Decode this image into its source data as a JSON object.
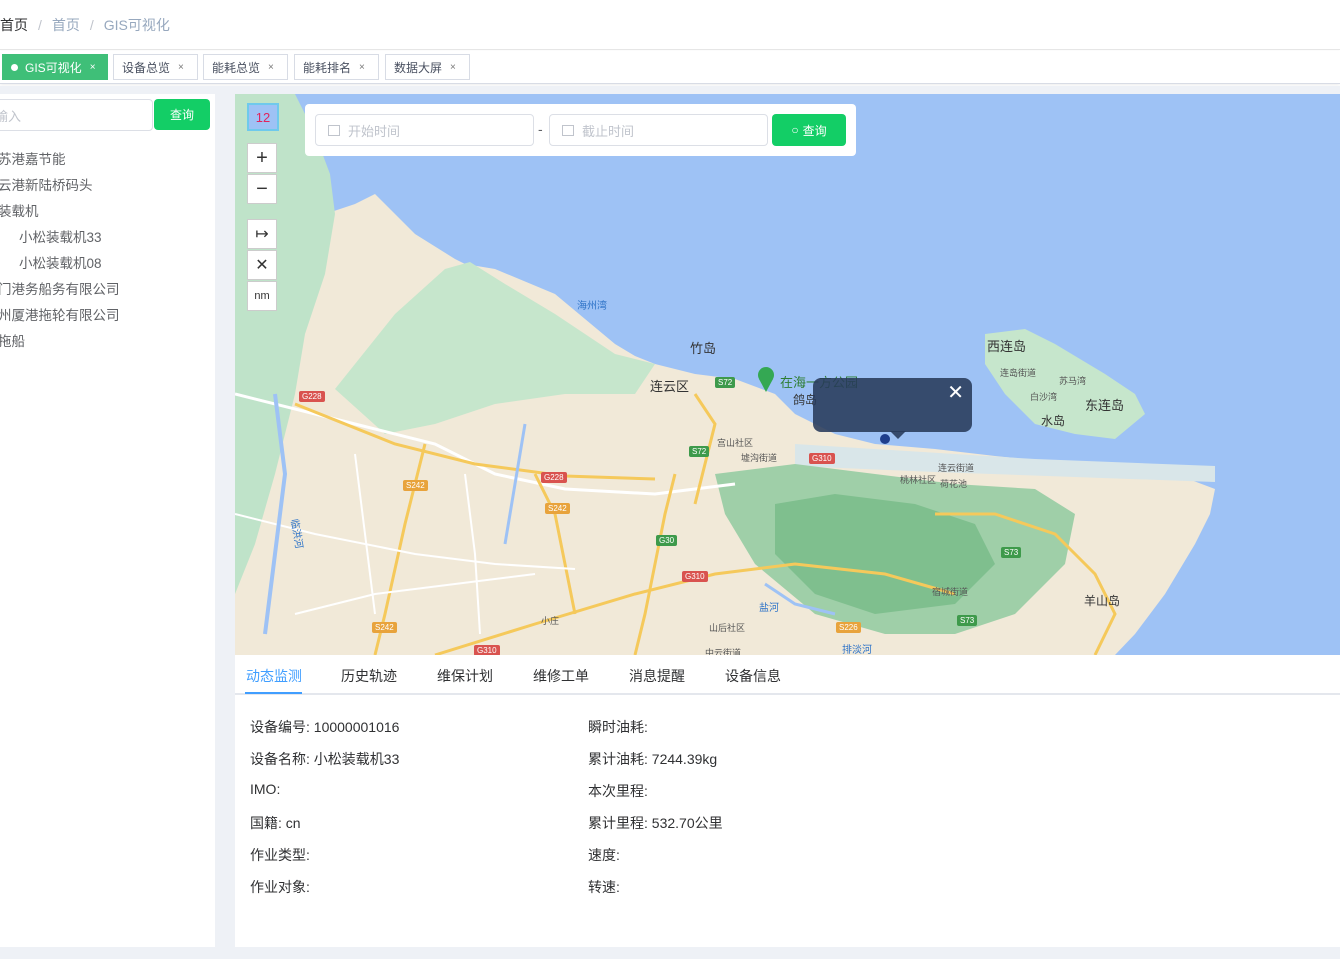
{
  "breadcrumb": [
    "首页",
    "首页",
    "GIS可视化"
  ],
  "tabs": [
    {
      "label": "GIS可视化",
      "active": true
    },
    {
      "label": "设备总览"
    },
    {
      "label": "能耗总览"
    },
    {
      "label": "能耗排名"
    },
    {
      "label": "数据大屏"
    }
  ],
  "tab_close": "×",
  "left": {
    "search_placeholder": "输入",
    "search_button": "查询",
    "tree": [
      "苏港嘉节能",
      "云港新陆桥码头",
      "装载机",
      "小松装载机33",
      "小松装载机08",
      "门港务船务有限公司",
      "州厦港拖轮有限公司",
      "拖船"
    ]
  },
  "map": {
    "zoom_level": "12",
    "zoom_in": "+",
    "zoom_out": "−",
    "measure": "↦",
    "clear": "✕",
    "unit": "nm",
    "start_placeholder": "开始时间",
    "dash": "-",
    "end_placeholder": "截止时间",
    "query": "查询",
    "popup_close": "✕",
    "labels": {
      "bay": "海州湾",
      "zhudao": "竹岛",
      "lianyun": "连云区",
      "park": "在海一方公园",
      "gedao": "鸽岛",
      "xilian": "西连岛",
      "donglian": "东连岛",
      "shuidao": "水岛",
      "yangshan": "羊山岛",
      "lianjie": "连岛街道",
      "susu": "苏马湾",
      "baisha": "白沙湾",
      "gongshan": "宫山社区",
      "xujie": "墟沟街道",
      "taolin": "桃林社区",
      "lianyunjie": "连云街道",
      "hehua": "荷花池",
      "sucheng": "宿城街道",
      "shanhou": "山后社区",
      "xiaozhuang": "小庄",
      "yanhe": "盐河",
      "paitan": "排淡河",
      "zhongyun": "中云街道",
      "linhong": "临洪河"
    },
    "shields": {
      "g228a": "G228",
      "g228b": "G228",
      "s72a": "S72",
      "s72b": "S72",
      "g310a": "G310",
      "g310b": "G310",
      "g310c": "G310",
      "s242a": "S242",
      "s242b": "S242",
      "s242c": "S242",
      "g30": "G30",
      "s73a": "S73",
      "s73b": "S73",
      "s226": "S226"
    }
  },
  "bottom": {
    "tabs": [
      "动态监测",
      "历史轨迹",
      "维保计划",
      "维修工单",
      "消息提醒",
      "设备信息"
    ],
    "left_fields": [
      "设备编号: 10000001016",
      "设备名称: 小松装载机33",
      "IMO:",
      "国籍: cn",
      "作业类型:",
      "作业对象:"
    ],
    "right_fields": [
      "瞬时油耗:",
      "累计油耗: 7244.39kg",
      "本次里程:",
      "累计里程: 532.70公里",
      "速度:",
      "转速:"
    ]
  }
}
